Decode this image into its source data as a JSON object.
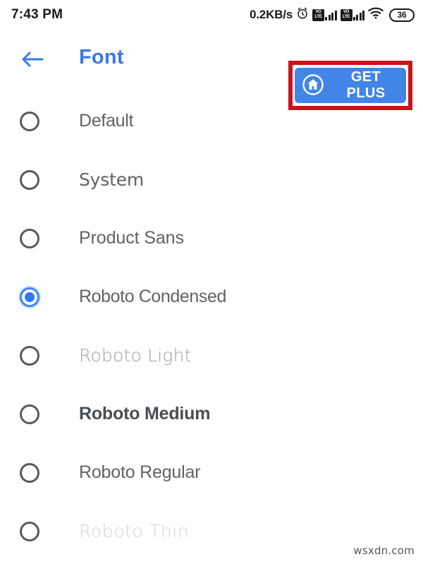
{
  "status_bar": {
    "time": "7:43 PM",
    "network_speed": "0.2KB/s",
    "alarm_icon": "alarm-clock-icon",
    "sim1_label_top": "VO",
    "sim1_label_bottom": "LTE",
    "sim2_label_top": "VO",
    "sim2_label_bottom": "LTE",
    "wifi_icon": "wifi-icon",
    "battery_level": "36"
  },
  "app_bar": {
    "back_icon": "back-arrow-icon",
    "title": "Font",
    "get_plus": {
      "label": "GET PLUS",
      "icon": "home-circle-icon",
      "background": "#4285e8"
    }
  },
  "annotation": {
    "color": "#cc1417"
  },
  "font_list": {
    "selected_index": 3,
    "options": [
      {
        "label": "Default",
        "style": "f-default",
        "selected": false
      },
      {
        "label": "System",
        "style": "f-system",
        "selected": false
      },
      {
        "label": "Product Sans",
        "style": "f-product",
        "selected": false
      },
      {
        "label": "Roboto Condensed",
        "style": "f-condensed",
        "selected": true
      },
      {
        "label": "Roboto Light",
        "style": "f-light",
        "selected": false
      },
      {
        "label": "Roboto Medium",
        "style": "f-medium",
        "selected": false
      },
      {
        "label": "Roboto Regular",
        "style": "f-regular",
        "selected": false
      },
      {
        "label": "Roboto Thin",
        "style": "f-thin",
        "selected": false
      }
    ]
  },
  "watermark": {
    "text": "wsxdn.com"
  },
  "colors": {
    "accent_blue": "#3b78e7",
    "radio_selected": "#4285f4",
    "text_default": "#5f6368",
    "annotation_red": "#cc1417"
  }
}
